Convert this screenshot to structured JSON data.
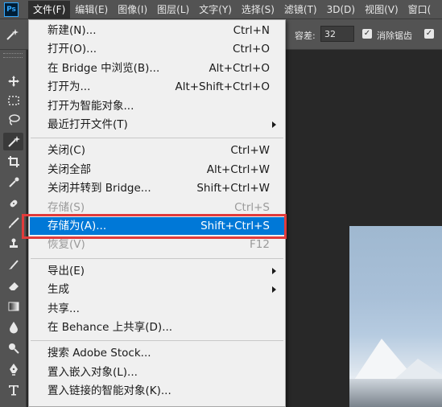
{
  "app": {
    "logo_text": "Ps"
  },
  "menubar": {
    "items": [
      {
        "label": "文件(F)",
        "active": true
      },
      {
        "label": "编辑(E)"
      },
      {
        "label": "图像(I)"
      },
      {
        "label": "图层(L)"
      },
      {
        "label": "文字(Y)"
      },
      {
        "label": "选择(S)"
      },
      {
        "label": "滤镜(T)"
      },
      {
        "label": "3D(D)"
      },
      {
        "label": "视图(V)"
      },
      {
        "label": "窗口("
      }
    ]
  },
  "options_bar": {
    "tolerance_label": "容差:",
    "tolerance_value": "32",
    "antialias_label": "消除锯齿",
    "antialias_checked": true,
    "contiguous_checked": true
  },
  "file_menu": {
    "items": [
      {
        "label": "新建(N)...",
        "shortcut": "Ctrl+N"
      },
      {
        "label": "打开(O)...",
        "shortcut": "Ctrl+O"
      },
      {
        "label": "在 Bridge 中浏览(B)...",
        "shortcut": "Alt+Ctrl+O"
      },
      {
        "label": "打开为...",
        "shortcut": "Alt+Shift+Ctrl+O"
      },
      {
        "label": "打开为智能对象...",
        "shortcut": ""
      },
      {
        "label": "最近打开文件(T)",
        "shortcut": "",
        "submenu": true
      },
      {
        "separator": true
      },
      {
        "label": "关闭(C)",
        "shortcut": "Ctrl+W"
      },
      {
        "label": "关闭全部",
        "shortcut": "Alt+Ctrl+W"
      },
      {
        "label": "关闭并转到 Bridge...",
        "shortcut": "Shift+Ctrl+W"
      },
      {
        "label": "存储(S)",
        "shortcut": "Ctrl+S",
        "disabled": true
      },
      {
        "label": "存储为(A)...",
        "shortcut": "Shift+Ctrl+S",
        "highlighted": true
      },
      {
        "label": "恢复(V)",
        "shortcut": "F12",
        "disabled": true
      },
      {
        "separator": true
      },
      {
        "label": "导出(E)",
        "shortcut": "",
        "submenu": true
      },
      {
        "label": "生成",
        "shortcut": "",
        "submenu": true
      },
      {
        "label": "共享...",
        "shortcut": ""
      },
      {
        "label": "在 Behance 上共享(D)...",
        "shortcut": ""
      },
      {
        "separator": true
      },
      {
        "label": "搜索 Adobe Stock...",
        "shortcut": ""
      },
      {
        "label": "置入嵌入对象(L)...",
        "shortcut": ""
      },
      {
        "label": "置入链接的智能对象(K)...",
        "shortcut": ""
      }
    ]
  },
  "colors": {
    "highlight": "#0078d7",
    "annotation_box": "#e23b3b",
    "menu_bg": "#f0f0f0",
    "app_chrome": "#535353"
  },
  "toolbar": {
    "tools": [
      {
        "name": "move-tool-icon"
      },
      {
        "name": "marquee-tool-icon"
      },
      {
        "name": "lasso-tool-icon"
      },
      {
        "name": "magic-wand-tool-icon",
        "selected": true
      },
      {
        "name": "crop-tool-icon"
      },
      {
        "name": "eyedropper-tool-icon"
      },
      {
        "name": "healing-brush-tool-icon"
      },
      {
        "name": "brush-tool-icon"
      },
      {
        "name": "clone-stamp-tool-icon"
      },
      {
        "name": "history-brush-tool-icon"
      },
      {
        "name": "eraser-tool-icon"
      },
      {
        "name": "gradient-tool-icon"
      },
      {
        "name": "blur-tool-icon"
      },
      {
        "name": "dodge-tool-icon"
      },
      {
        "name": "pen-tool-icon"
      },
      {
        "name": "type-tool-icon"
      }
    ]
  }
}
